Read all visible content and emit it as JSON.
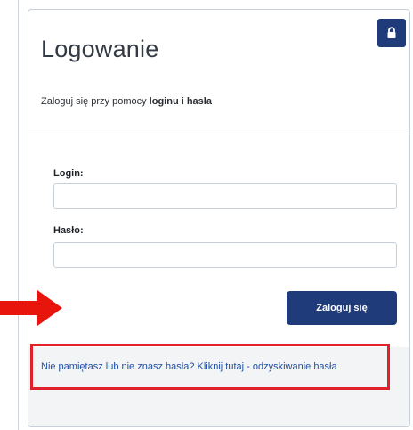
{
  "login_panel": {
    "title": "Logowanie",
    "subtitle_prefix": "Zaloguj się przy pomocy ",
    "subtitle_bold": "loginu i hasła",
    "lock_icon": "lock-icon",
    "login_label": "Login:",
    "login_value": "",
    "password_label": "Hasło:",
    "password_value": "",
    "submit_label": "Zaloguj się",
    "recover_link": "Nie pamiętasz lub nie znasz hasła? Kliknij tutaj - odzyskiwanie hasła"
  },
  "annotations": {
    "arrow_icon": "right-arrow-icon",
    "arrow_color": "#e8150c",
    "highlight_color": "#e0202a"
  },
  "colors": {
    "primary": "#1f3b7a",
    "link": "#1f4fa3",
    "footer_bg": "#f3f4f6"
  }
}
